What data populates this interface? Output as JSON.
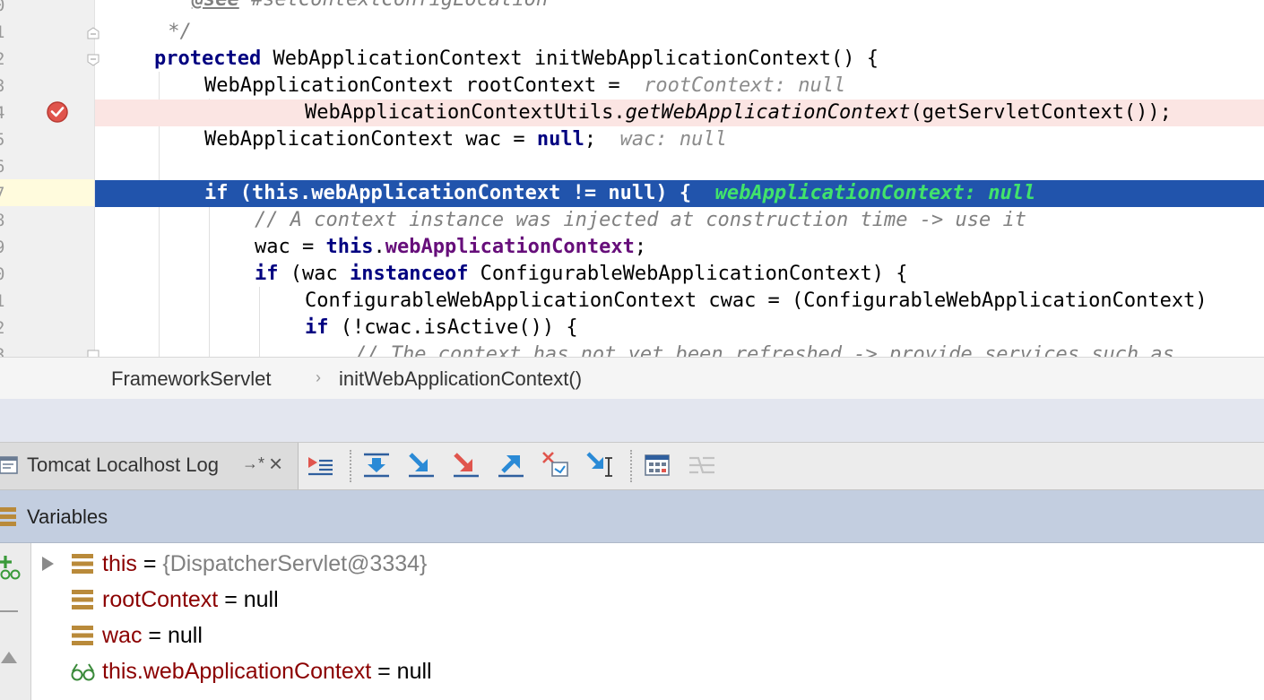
{
  "editor": {
    "line_numbers": [
      "0",
      "1",
      "2",
      "3",
      "4",
      "5",
      "6",
      "7",
      "8",
      "9",
      "0",
      "1",
      "2",
      "3"
    ],
    "lines": {
      "l0": {
        "comment_prefix": " * ",
        "tag": "@see",
        "comment_rest": " #setContextConfigLocation"
      },
      "l1": {
        "comment": " */"
      },
      "l2": {
        "kw": "protected",
        "rest": " WebApplicationContext initWebApplicationContext() {"
      },
      "l3": {
        "code": "WebApplicationContext rootContext = ",
        "hint": "rootContext: null"
      },
      "l4": {
        "pre": "WebApplicationContextUtils.",
        "italic": "getWebApplicationContext",
        "post": "(getServletContext());"
      },
      "l5": {
        "pre": "WebApplicationContext wac = ",
        "kw": "null",
        "post": ";",
        "hint": "wac: null"
      },
      "l7": {
        "kw1": "if",
        "mid1": " (",
        "kw2": "this",
        "mid2": ".webApplicationContext != ",
        "kw3": "null",
        "mid3": ") {",
        "hint": "webApplicationContext: null"
      },
      "l8": {
        "comment": "// A context instance was injected at construction time -> use it"
      },
      "l9": {
        "pre": "wac = ",
        "kw": "this",
        "dot": ".",
        "field": "webApplicationContext",
        "post": ";"
      },
      "l10": {
        "kw1": "if",
        "mid": " (wac ",
        "kw2": "instanceof",
        "post": " ConfigurableWebApplicationContext) {"
      },
      "l11": {
        "code": "ConfigurableWebApplicationContext cwac = (ConfigurableWebApplicationContext)"
      },
      "l12": {
        "kw": "if",
        "post": " (!cwac.isActive()) {"
      },
      "l13": {
        "comment": "// The context has not yet been refreshed -> provide services such as"
      }
    }
  },
  "breadcrumb": {
    "class_name": "FrameworkServlet",
    "separator": "›",
    "method": "initWebApplicationContext()"
  },
  "debug_tab": {
    "label": "Tomcat Localhost Log",
    "pin": "→*",
    "close": "×"
  },
  "toolbar_icons": [
    "show-execution-point-icon",
    "step-over-icon",
    "step-into-icon",
    "force-step-into-icon",
    "step-out-icon",
    "drop-frame-icon",
    "run-to-cursor-icon",
    "evaluate-expression-icon",
    "trace-icon"
  ],
  "variables": {
    "title": "Variables",
    "items": [
      {
        "name": "this",
        "eq": " = ",
        "value": "{DispatcherServlet@3334}",
        "expandable": true,
        "icon": "field-icon"
      },
      {
        "name": "rootContext",
        "eq": " = ",
        "value": "null",
        "expandable": false,
        "icon": "field-icon"
      },
      {
        "name": "wac",
        "eq": " = ",
        "value": "null",
        "expandable": false,
        "icon": "field-icon"
      },
      {
        "name": "this.webApplicationContext",
        "eq": " = ",
        "value": "null",
        "expandable": false,
        "icon": "watch-glasses-icon"
      }
    ]
  },
  "colors": {
    "current_line": "#2154ac",
    "error_line": "#fbe5e3",
    "hint_green": "#41e36b",
    "keyword": "#000080",
    "field": "#660e7a",
    "variable_name": "#8b0000"
  }
}
